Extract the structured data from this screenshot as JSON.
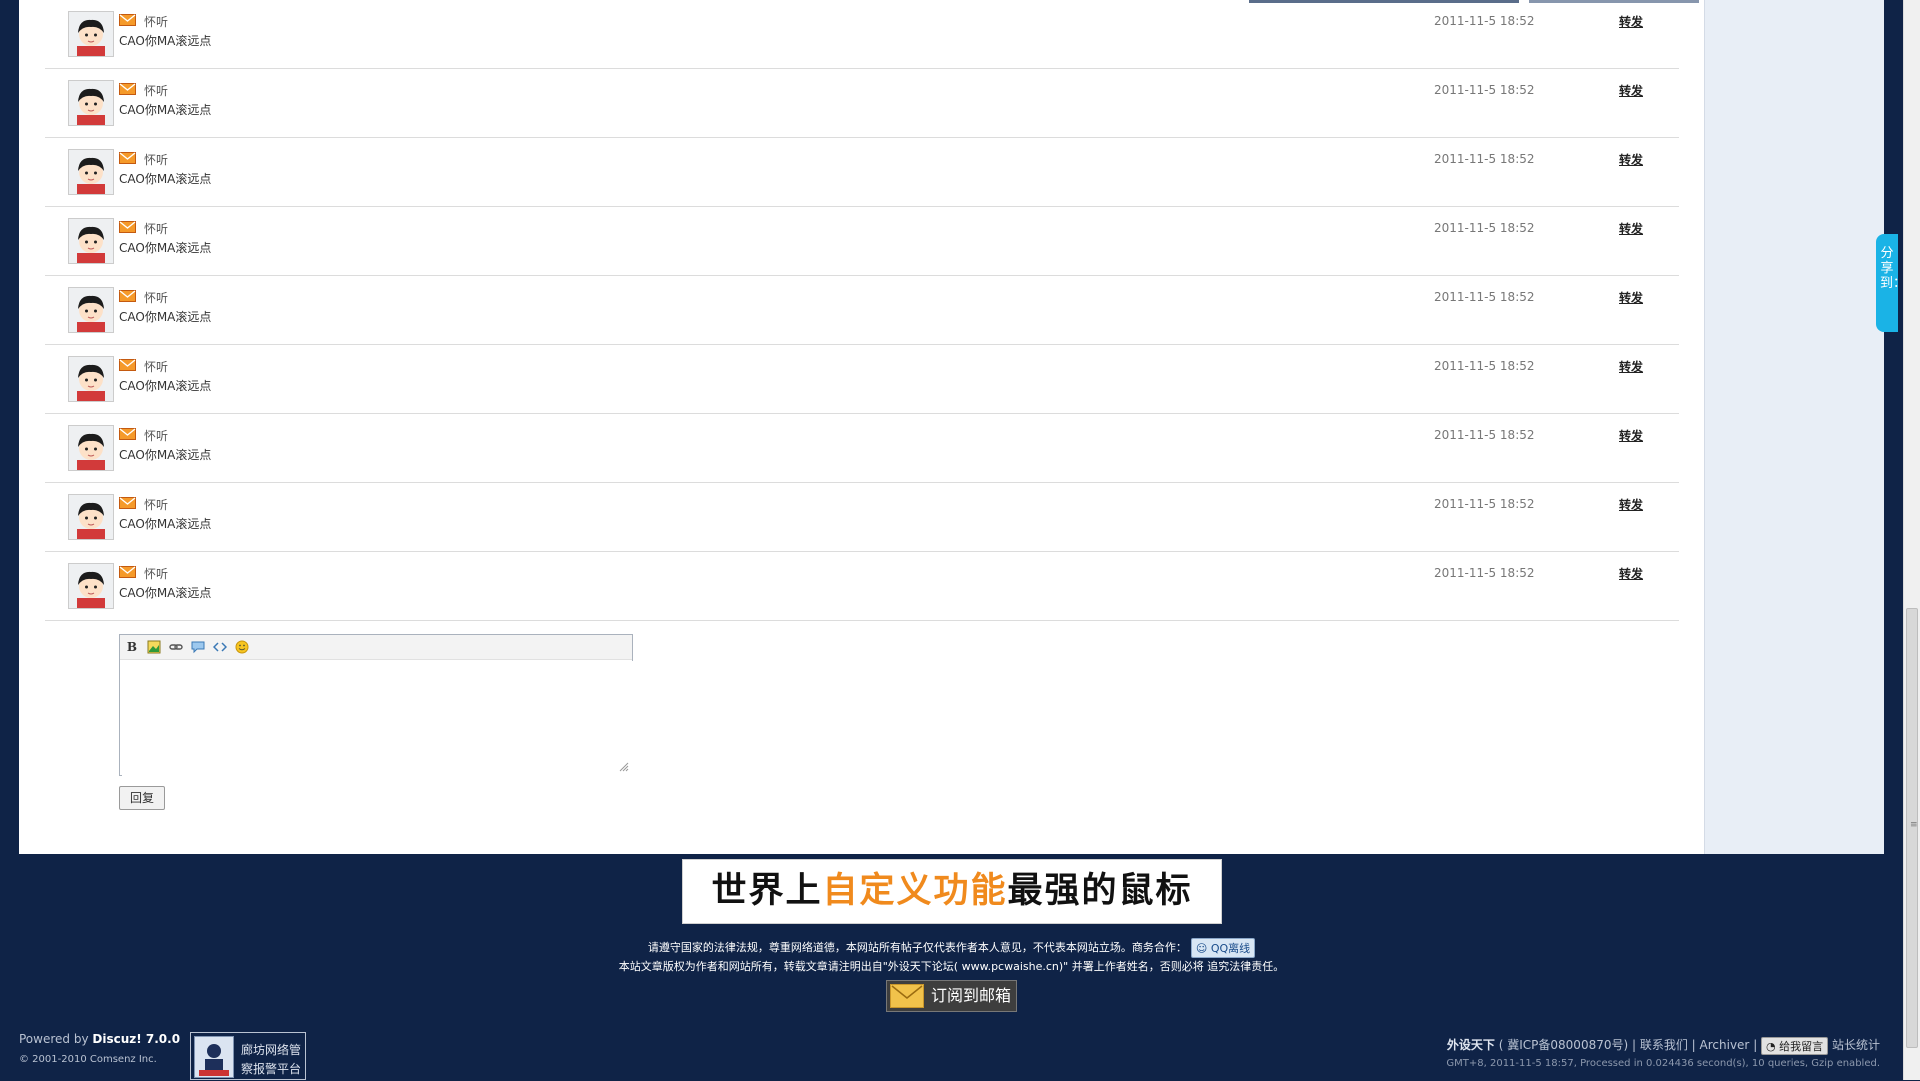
{
  "comments": [
    {
      "author": "怀听",
      "text": "CAO你MA滚远点",
      "time": "2011-11-5 18:52",
      "action": "转发"
    },
    {
      "author": "怀听",
      "text": "CAO你MA滚远点",
      "time": "2011-11-5 18:52",
      "action": "转发"
    },
    {
      "author": "怀听",
      "text": "CAO你MA滚远点",
      "time": "2011-11-5 18:52",
      "action": "转发"
    },
    {
      "author": "怀听",
      "text": "CAO你MA滚远点",
      "time": "2011-11-5 18:52",
      "action": "转发"
    },
    {
      "author": "怀听",
      "text": "CAO你MA滚远点",
      "time": "2011-11-5 18:52",
      "action": "转发"
    },
    {
      "author": "怀听",
      "text": "CAO你MA滚远点",
      "time": "2011-11-5 18:52",
      "action": "转发"
    },
    {
      "author": "怀听",
      "text": "CAO你MA滚远点",
      "time": "2011-11-5 18:52",
      "action": "转发"
    },
    {
      "author": "怀听",
      "text": "CAO你MA滚远点",
      "time": "2011-11-5 18:52",
      "action": "转发"
    },
    {
      "author": "怀听",
      "text": "CAO你MA滚远点",
      "time": "2011-11-5 18:52",
      "action": "转发"
    }
  ],
  "editor": {
    "toolbar": [
      "bold-icon",
      "image-icon",
      "link-icon",
      "quote-icon",
      "code-icon",
      "smiley-icon"
    ],
    "bold_label": "B",
    "reply_label": "回复"
  },
  "share_tab": {
    "label": "分享到：",
    "color": "#1ab3e6"
  },
  "banner": {
    "part1": "世界上",
    "highlight": "自定义功能",
    "part2": "最强的鼠标",
    "highlight_color": "#f08a1d"
  },
  "notice": {
    "line1": "请遵守国家的法律法规，尊重网络道德，本网站所有帖子仅代表作者本人意见，不代表本网站立场。商务合作：",
    "qq_label": "QQ离线",
    "line2": "本站文章版权为作者和网站所有，转载文章请注明出自\"外设天下论坛( www.pcwaishe.cn)\" 并署上作者姓名，否则必将 追究法律责任。"
  },
  "subscribe": {
    "label": "订阅到邮箱"
  },
  "footer": {
    "powered_prefix": "Powered by ",
    "powered_name": "Discuz! 7.0.0",
    "copyright": "© 2001-2010 Comsenz Inc.",
    "badge_line1": "廊坊网络管",
    "badge_line2": "察报警平台",
    "site_name": "外设天下",
    "icp": "( 冀ICP备08000870号)",
    "contact": "联系我们",
    "archiver": "Archiver",
    "message_label": "给我留言",
    "stats": "站长统计",
    "processed": "GMT+8, 2011-11-5 18:57, Processed in 0.024436 second(s), 10 queries, Gzip enabled."
  },
  "colors": {
    "page_bg": "#0f2347",
    "content_bg": "#ffffff",
    "sidebar_bg": "#e8eef6"
  }
}
